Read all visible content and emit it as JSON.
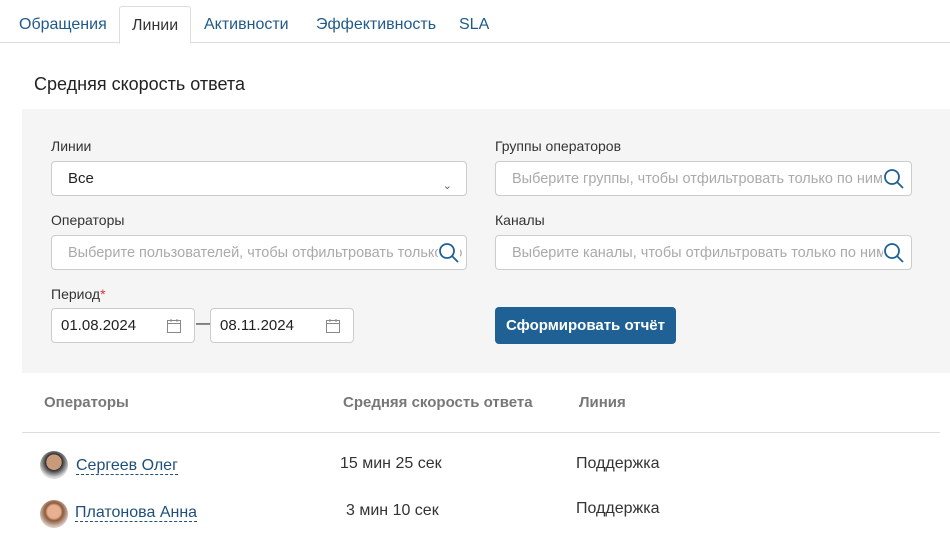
{
  "tabs": [
    {
      "label": "Обращения"
    },
    {
      "label": "Линии",
      "active": true
    },
    {
      "label": "Активности"
    },
    {
      "label": "Эффективность"
    },
    {
      "label": "SLA"
    }
  ],
  "report_title": "Средняя скорость ответа",
  "filters": {
    "lines_label": "Линии",
    "lines_value": "Все",
    "groups_label": "Группы операторов",
    "groups_placeholder": "Выберите группы, чтобы отфильтровать только по ним",
    "operators_label": "Операторы",
    "operators_placeholder": "Выберите пользователей, чтобы отфильтровать только по ним",
    "channels_label": "Каналы",
    "channels_placeholder": "Выберите каналы, чтобы отфильтровать только по ним",
    "period_label": "Период",
    "required_mark": "*",
    "date_from": "01.08.2024",
    "date_sep": "—",
    "date_to": "08.11.2024",
    "submit_label": "Сформировать отчёт"
  },
  "table": {
    "headers": [
      "Операторы",
      "Средняя скорость ответа",
      "Линия"
    ],
    "rows": [
      {
        "operator": "Сергеев Олег",
        "speed": "15 мин 25 сек",
        "line": "Поддержка"
      },
      {
        "operator": "Платонова Анна",
        "speed": "3 мин 10 сек",
        "line": "Поддержка"
      }
    ]
  },
  "colors": {
    "accent": "#1f6194",
    "link": "#1f4f7a"
  }
}
